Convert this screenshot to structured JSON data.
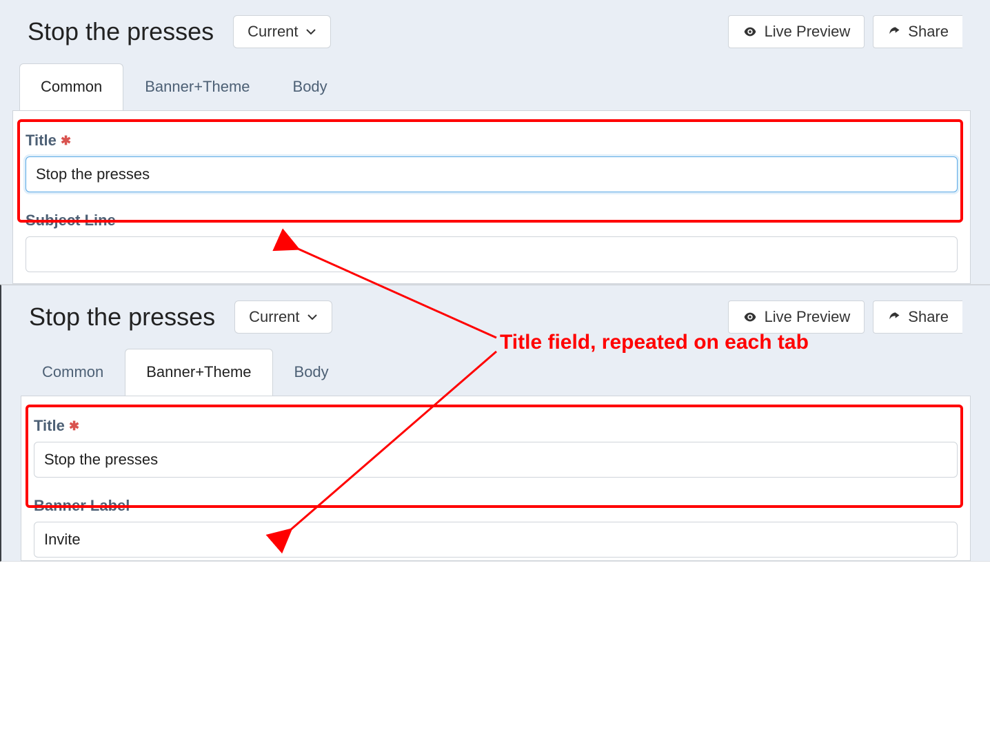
{
  "header": {
    "title": "Stop the presses",
    "version_label": "Current",
    "actions": {
      "live_preview": "Live Preview",
      "share": "Share"
    }
  },
  "tabs": [
    "Common",
    "Banner+Theme",
    "Body"
  ],
  "panel1": {
    "active_tab_index": 0,
    "fields": {
      "title": {
        "label": "Title",
        "required": true,
        "value": "Stop the presses"
      },
      "subject": {
        "label": "Subject Line",
        "value": ""
      }
    }
  },
  "panel2": {
    "active_tab_index": 1,
    "fields": {
      "title": {
        "label": "Title",
        "required": true,
        "value": "Stop the presses"
      },
      "banner_label": {
        "label": "Banner Label",
        "value": "Invite"
      }
    }
  },
  "annotation": {
    "callout": "Title field, repeated on each tab"
  },
  "colors": {
    "panel_bg": "#e9eef5",
    "tab_text": "#4d6075",
    "border": "#cfd4da",
    "focus": "#5aa9e6",
    "highlight": "#ff0000",
    "required": "#d9534f"
  }
}
